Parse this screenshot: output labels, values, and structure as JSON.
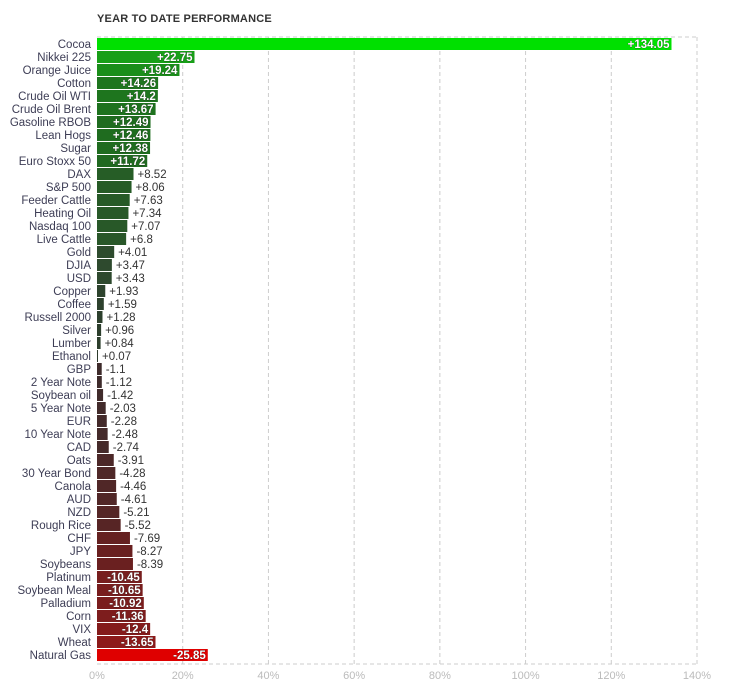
{
  "chart_data": {
    "type": "bar",
    "orientation": "horizontal",
    "title": "YEAR TO DATE PERFORMANCE",
    "xlabel": "",
    "ylabel": "",
    "xlim": [
      0,
      140
    ],
    "xticks": [
      "0%",
      "20%",
      "40%",
      "60%",
      "80%",
      "100%",
      "120%",
      "140%"
    ],
    "bar_length": "absolute value",
    "grid": true,
    "colors": {
      "positive_max": "#00e000",
      "positive_min": "#2c3a2c",
      "negative_min": "#3a2c2c",
      "negative_max": "#e00000"
    },
    "categories": [
      "Cocoa",
      "Nikkei 225",
      "Orange Juice",
      "Cotton",
      "Crude Oil WTI",
      "Crude Oil Brent",
      "Gasoline RBOB",
      "Lean Hogs",
      "Sugar",
      "Euro Stoxx 50",
      "DAX",
      "S&P 500",
      "Feeder Cattle",
      "Heating Oil",
      "Nasdaq 100",
      "Live Cattle",
      "Gold",
      "DJIA",
      "USD",
      "Copper",
      "Coffee",
      "Russell 2000",
      "Silver",
      "Lumber",
      "Ethanol",
      "GBP",
      "2 Year Note",
      "Soybean oil",
      "5 Year Note",
      "EUR",
      "10 Year Note",
      "CAD",
      "Oats",
      "30 Year Bond",
      "Canola",
      "AUD",
      "NZD",
      "Rough Rice",
      "CHF",
      "JPY",
      "Soybeans",
      "Platinum",
      "Soybean Meal",
      "Palladium",
      "Corn",
      "VIX",
      "Wheat",
      "Natural Gas"
    ],
    "values": [
      134.05,
      22.75,
      19.24,
      14.26,
      14.2,
      13.67,
      12.49,
      12.46,
      12.38,
      11.72,
      8.52,
      8.06,
      7.63,
      7.34,
      7.07,
      6.8,
      4.01,
      3.47,
      3.43,
      1.93,
      1.59,
      1.28,
      0.96,
      0.84,
      0.07,
      -1.1,
      -1.12,
      -1.42,
      -2.03,
      -2.28,
      -2.48,
      -2.74,
      -3.91,
      -4.28,
      -4.46,
      -4.61,
      -5.21,
      -5.52,
      -7.69,
      -8.27,
      -8.39,
      -10.45,
      -10.65,
      -10.92,
      -11.36,
      -12.4,
      -13.65,
      -25.85
    ],
    "labels": [
      "+134.05",
      "+22.75",
      "+19.24",
      "+14.26",
      "+14.2",
      "+13.67",
      "+12.49",
      "+12.46",
      "+12.38",
      "+11.72",
      "+8.52",
      "+8.06",
      "+7.63",
      "+7.34",
      "+7.07",
      "+6.8",
      "+4.01",
      "+3.47",
      "+3.43",
      "+1.93",
      "+1.59",
      "+1.28",
      "+0.96",
      "+0.84",
      "+0.07",
      "-1.1",
      "-1.12",
      "-1.42",
      "-2.03",
      "-2.28",
      "-2.48",
      "-2.74",
      "-3.91",
      "-4.28",
      "-4.46",
      "-4.61",
      "-5.21",
      "-5.52",
      "-7.69",
      "-8.27",
      "-8.39",
      "-10.45",
      "-10.65",
      "-10.92",
      "-11.36",
      "-12.4",
      "-13.65",
      "-25.85"
    ]
  }
}
